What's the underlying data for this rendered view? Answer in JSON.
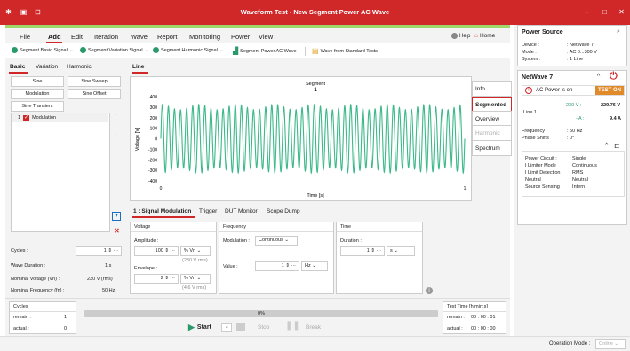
{
  "window": {
    "title": "Waveform Test - New Segment Power AC Wave"
  },
  "menu": {
    "items": [
      "File",
      "Add",
      "Edit",
      "Iteration",
      "Wave",
      "Report",
      "Monitoring",
      "Power",
      "View"
    ],
    "help": "Help",
    "home": "Home"
  },
  "toolbar": {
    "seg_basic": "Segment Basic Signal",
    "seg_var": "Segment Variation Signal",
    "seg_harm": "Segment Harmonic Signal",
    "seg_power": "Segment Power AC Wave",
    "from_std": "Wave from Standard Tests"
  },
  "left": {
    "tabs": [
      "Basic",
      "Variation",
      "Harmonic"
    ],
    "buttons": [
      "Sine",
      "Sine Sweep",
      "Modulation",
      "Sine Offset",
      "Sine Transient"
    ],
    "seg_item": "1",
    "seg_label": "Modulation",
    "cycles_label": "Cycles :",
    "cycles_value": "1",
    "wave_duration_label": "Wave Duration :",
    "wave_duration_value": "1 s",
    "nominal_voltage_label": "Nominal Voltage (Vn) :",
    "nominal_voltage_value": "230 V (rms)",
    "nominal_freq_label": "Nominal Frequency (fn) :",
    "nominal_freq_value": "50 Hz"
  },
  "line_tab": "Line",
  "chart_data": {
    "type": "line",
    "title": "Segment",
    "subtitle": "1",
    "xlabel": "Time [s]",
    "ylabel": "Voltage [V]",
    "yticks": [
      "400",
      "300",
      "200",
      "100",
      "0",
      "-100",
      "-200",
      "-300",
      "-400"
    ],
    "xticks": [
      "0",
      "1"
    ],
    "ylim": [
      -400,
      400
    ],
    "xlim": [
      0,
      1
    ],
    "series": [
      {
        "color": "#3cb88a",
        "frequency_hz": 50,
        "amplitude_peak_v": 325,
        "modulation": "amplitude-modulated sine"
      }
    ]
  },
  "side_tabs": [
    "Info",
    "Segmented",
    "Overview",
    "Harmonic",
    "Spectrum"
  ],
  "bottom_tabs": [
    "1 : Signal Modulation",
    "Trigger",
    "DUT Monitor",
    "Scope Dump"
  ],
  "voltage": {
    "title": "Voltage",
    "amplitude_label": "Amplitude :",
    "amplitude_value": "100",
    "amplitude_unit": "% Vn",
    "amplitude_rms": "(230 V rms)",
    "envelope_label": "Envelope :",
    "envelope_value": "2",
    "envelope_unit": "% Vn",
    "envelope_rms": "(4.6 V rms)"
  },
  "frequency": {
    "title": "Frequency",
    "modulation_label": "Modulation :",
    "modulation_value": "Continuous",
    "value_label": "Value :",
    "value_value": "1",
    "value_unit": "Hz"
  },
  "time": {
    "title": "Time",
    "duration_label": "Duration :",
    "duration_value": "1",
    "duration_unit": "s"
  },
  "cycles_box": {
    "title": "Cycles",
    "remain_label": "remain :",
    "remain_value": "1",
    "actual_label": "actual :",
    "actual_value": "0"
  },
  "progress": {
    "percent_label": "0%",
    "percent": 0
  },
  "controls": {
    "start": "Start",
    "stop": "Stop",
    "break": "Break"
  },
  "test_time": {
    "title": "Test Time [h:min:s]",
    "remain_label": "remain :",
    "remain_value": "00 : 00 : 01",
    "actual_label": "actual :",
    "actual_value": "00 : 00 : 00"
  },
  "power_source": {
    "title": "Power Source",
    "device_label": "Device :",
    "device_value": ": NetWave 7",
    "mode_label": "Mode :",
    "mode_value": ": AC 0...300 V",
    "system_label": "System :",
    "system_value": ": 1 Line"
  },
  "netwave": {
    "title": "NetWave 7",
    "ac_status": "AC Power is on",
    "test_on": "TEST ON",
    "line_label": "Line 1",
    "v_set": "230 V :",
    "v_meas": "229.76 V",
    "a_set": "- A :",
    "a_meas": "9.4 A",
    "freq_label": "Frequency",
    "freq_value": ": 50 Hz",
    "phase_label": "Phase Shifts",
    "phase_value": ": 0°",
    "rows": [
      [
        "Power Circuit :",
        ": Single"
      ],
      [
        "I Limiter Mode",
        ": Continuous"
      ],
      [
        "I Limit Detection",
        ": RMS"
      ],
      [
        "Neutral",
        ": Neutral"
      ],
      [
        "Source Sensing",
        ": Intern"
      ]
    ]
  },
  "status": {
    "operation_mode_label": "Operation Mode :",
    "operation_mode_value": "Online"
  }
}
